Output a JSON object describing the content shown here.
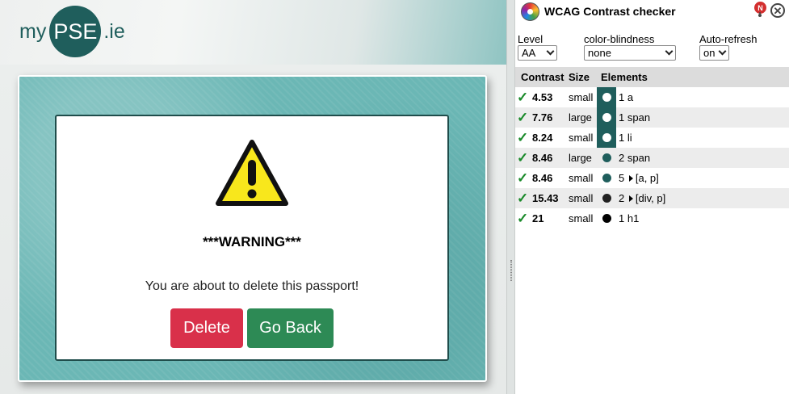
{
  "site": {
    "logo": {
      "prefix": "my",
      "badge": "PSE",
      "suffix": ".ie"
    },
    "dialog": {
      "title": "***WARNING***",
      "message": "You are about to delete this passport!",
      "delete_label": "Delete",
      "back_label": "Go Back"
    },
    "colors": {
      "brand": "#1f5e5c",
      "delete": "#d9304a",
      "back": "#2d8a55",
      "panel": "#6bb7b5"
    }
  },
  "checker": {
    "title": "WCAG Contrast checker",
    "notification_badge": "N",
    "controls": {
      "level": {
        "label": "Level",
        "value": "AA"
      },
      "color_blindness": {
        "label": "color-blindness",
        "value": "none"
      },
      "auto_refresh": {
        "label": "Auto-refresh",
        "value": "on"
      }
    },
    "columns": {
      "contrast": "Contrast",
      "size": "Size",
      "elements": "Elements"
    },
    "rows": [
      {
        "ratio": "4.53",
        "size": "small",
        "count": "1",
        "elements": "a",
        "expandable": false,
        "fg": "#ffffff",
        "bg": "#1f5e5c"
      },
      {
        "ratio": "7.76",
        "size": "large",
        "count": "1",
        "elements": "span",
        "expandable": false,
        "fg": "#ffffff",
        "bg": "#1f5e5c"
      },
      {
        "ratio": "8.24",
        "size": "small",
        "count": "1",
        "elements": "li",
        "expandable": false,
        "fg": "#ffffff",
        "bg": "#1f5e5c"
      },
      {
        "ratio": "8.46",
        "size": "large",
        "count": "2",
        "elements": "span",
        "expandable": false,
        "fg": "#1f5e5c",
        "bg": ""
      },
      {
        "ratio": "8.46",
        "size": "small",
        "count": "5",
        "elements": "[a, p]",
        "expandable": true,
        "fg": "#1f5e5c",
        "bg": ""
      },
      {
        "ratio": "15.43",
        "size": "small",
        "count": "2",
        "elements": "[div, p]",
        "expandable": true,
        "fg": "#222222",
        "bg": ""
      },
      {
        "ratio": "21",
        "size": "small",
        "count": "1",
        "elements": "h1",
        "expandable": false,
        "fg": "#000000",
        "bg": ""
      }
    ]
  }
}
